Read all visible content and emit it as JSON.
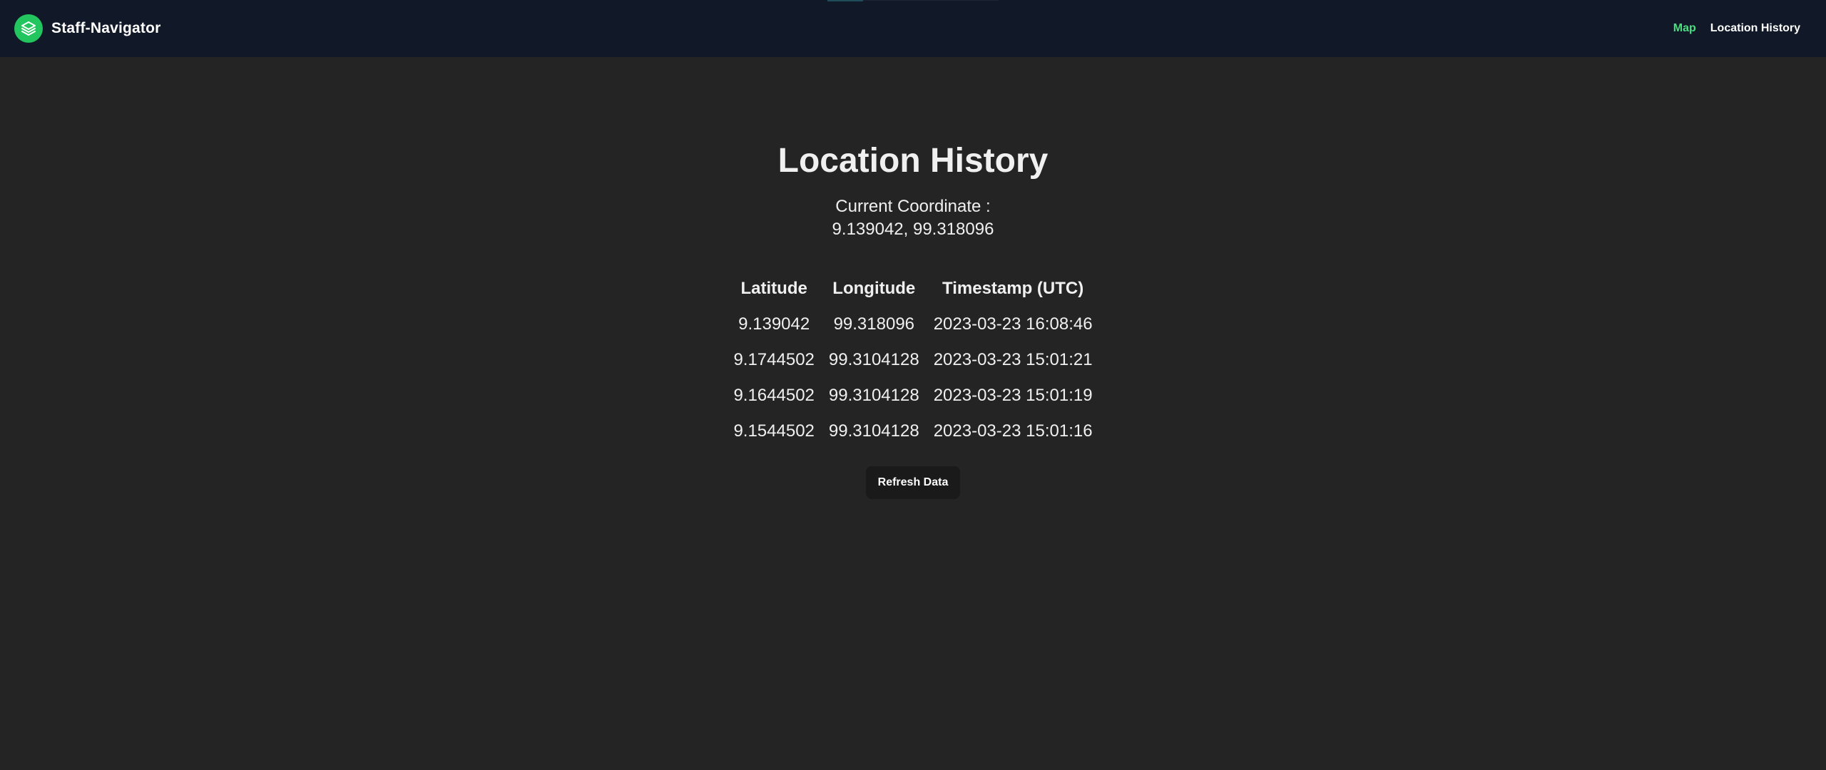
{
  "header": {
    "brand_name": "Staff-Navigator",
    "brand_icon": "layers-icon",
    "brand_color": "#22c55e",
    "nav": [
      {
        "label": "Map",
        "active": true
      },
      {
        "label": "Location History",
        "active": false
      }
    ]
  },
  "main": {
    "title": "Location History",
    "current_label": "Current Coordinate :",
    "current_value": "9.139042, 99.318096",
    "columns": [
      "Latitude",
      "Longitude",
      "Timestamp (UTC)"
    ],
    "rows": [
      {
        "latitude": "9.139042",
        "longitude": "99.318096",
        "timestamp": "2023-03-23 16:08:46"
      },
      {
        "latitude": "9.1744502",
        "longitude": "99.3104128",
        "timestamp": "2023-03-23 15:01:21"
      },
      {
        "latitude": "9.1644502",
        "longitude": "99.3104128",
        "timestamp": "2023-03-23 15:01:19"
      },
      {
        "latitude": "9.1544502",
        "longitude": "99.3104128",
        "timestamp": "2023-03-23 15:01:16"
      }
    ],
    "refresh_label": "Refresh Data"
  }
}
